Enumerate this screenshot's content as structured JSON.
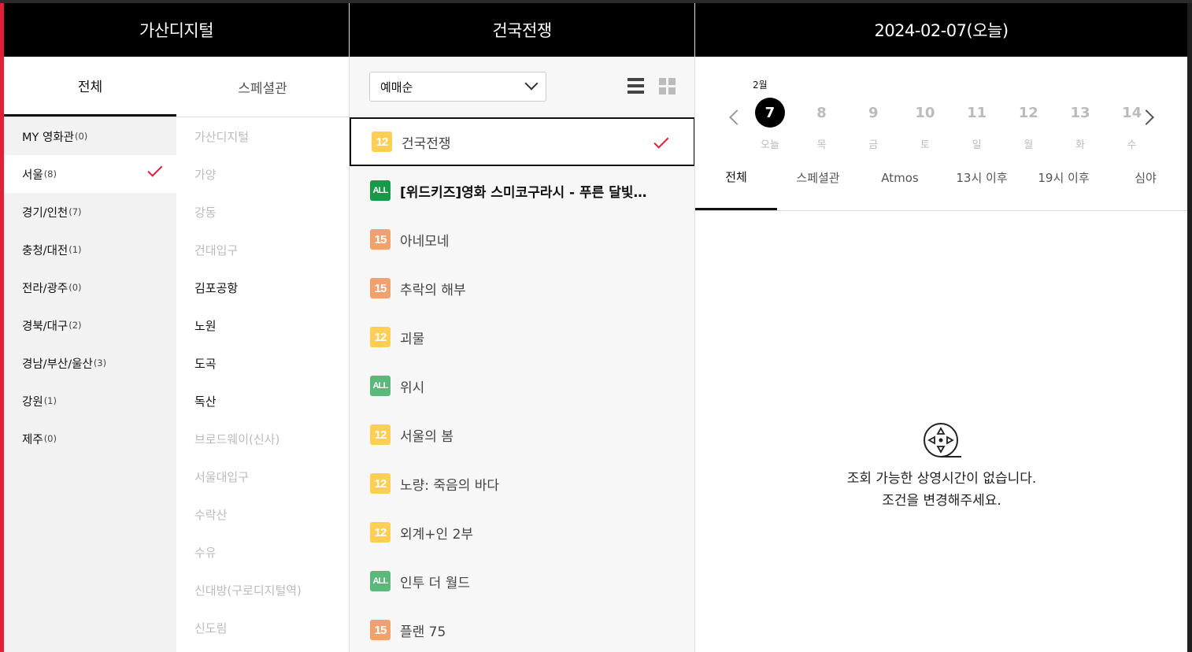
{
  "cinema": {
    "header": "가산디지털",
    "tabs": [
      "전체",
      "스페셜관"
    ],
    "regions": [
      {
        "name": "MY 영화관",
        "count": "(0)"
      },
      {
        "name": "서울",
        "count": "(8)"
      },
      {
        "name": "경기/인천",
        "count": "(7)"
      },
      {
        "name": "충청/대전",
        "count": "(1)"
      },
      {
        "name": "전라/광주",
        "count": "(0)"
      },
      {
        "name": "경북/대구",
        "count": "(2)"
      },
      {
        "name": "경남/부산/울산",
        "count": "(3)"
      },
      {
        "name": "강원",
        "count": "(1)"
      },
      {
        "name": "제주",
        "count": "(0)"
      }
    ],
    "theaters": [
      "가산디지털",
      "가양",
      "강동",
      "건대입구",
      "김포공항",
      "노원",
      "도곡",
      "독산",
      "브로드웨이(신사)",
      "서울대입구",
      "수락산",
      "수유",
      "신대방(구로디지털역)",
      "신도림"
    ]
  },
  "movie": {
    "header": "건국전쟁",
    "sort_value": "예매순",
    "items": [
      {
        "rating": "12",
        "title": "건국전쟁"
      },
      {
        "rating": "ALL",
        "title": "[위드키즈]영화 스미코구라시 - 푸른 달빛의 마법의 아이"
      },
      {
        "rating": "15",
        "title": "아네모네"
      },
      {
        "rating": "15",
        "title": "추락의 해부"
      },
      {
        "rating": "12",
        "title": "괴물"
      },
      {
        "rating": "ALL",
        "title": "위시"
      },
      {
        "rating": "12",
        "title": "서울의 봄"
      },
      {
        "rating": "12",
        "title": "노량: 죽음의 바다"
      },
      {
        "rating": "12",
        "title": "외계+인 2부"
      },
      {
        "rating": "ALL",
        "title": "인투 더 월드"
      },
      {
        "rating": "15",
        "title": "플랜 75"
      }
    ]
  },
  "schedule": {
    "header": "2024-02-07(오늘)",
    "month": "2월",
    "days": [
      {
        "num": "7",
        "wd": "오늘"
      },
      {
        "num": "8",
        "wd": "목"
      },
      {
        "num": "9",
        "wd": "금"
      },
      {
        "num": "10",
        "wd": "토"
      },
      {
        "num": "11",
        "wd": "일"
      },
      {
        "num": "12",
        "wd": "월"
      },
      {
        "num": "13",
        "wd": "화"
      },
      {
        "num": "14",
        "wd": "수"
      }
    ],
    "tabs": [
      "전체",
      "스페셜관",
      "Atmos",
      "13시 이후",
      "19시 이후",
      "심야"
    ],
    "empty_line1": "조회 가능한 상영시간이 없습니다.",
    "empty_line2": "조건을 변경해주세요."
  }
}
